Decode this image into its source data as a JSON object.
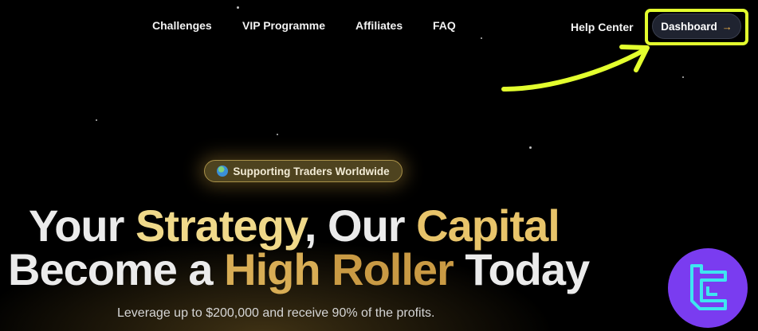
{
  "nav": {
    "links": [
      "Challenges",
      "VIP Programme",
      "Affiliates",
      "FAQ"
    ],
    "help_center": "Help Center",
    "dashboard_label": "Dashboard",
    "dashboard_arrow": "→"
  },
  "hero": {
    "badge_text": "Supporting Traders Worldwide",
    "line1": {
      "a": "Your ",
      "b": "Strategy",
      "c": ", Our ",
      "d": "Capital"
    },
    "line2": {
      "a": "Become a ",
      "b": "High ",
      "c": "Roller",
      "d": " Today"
    },
    "subtitle": "Leverage up to $200,000 and receive 90% of the profits."
  },
  "colors": {
    "highlight_box": "#e3ff2e",
    "gold": "#e8c46a",
    "logo_purple": "#7a3cf0",
    "logo_cyan": "#3ee6f0"
  },
  "icons": {
    "badge": "globe-icon",
    "dashboard": "arrow-right-icon",
    "annotation": "hand-drawn-arrow-icon",
    "watermark": "tradingfinder-logo-icon"
  }
}
